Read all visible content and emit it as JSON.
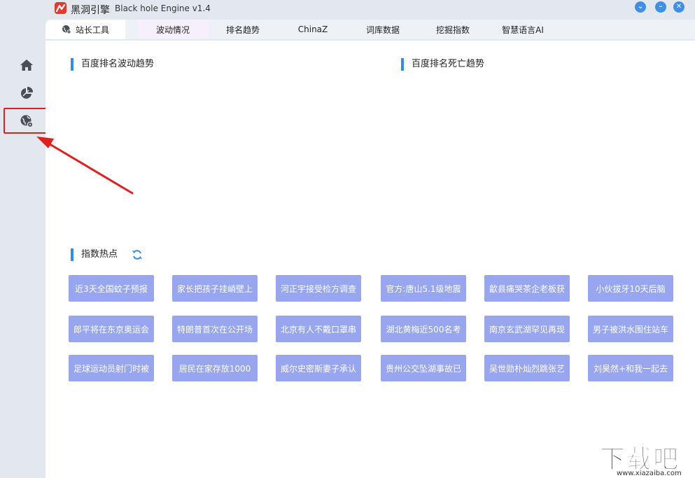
{
  "app": {
    "title": "黑洞引擎",
    "subtitle": "Black hole Engine v1.4",
    "accent": "#3f8fe6",
    "logo_color": "#e33a2c"
  },
  "window_controls": [
    {
      "name": "collapse",
      "glyph": "⌄",
      "icon": "chevron-down-icon"
    },
    {
      "name": "minimize",
      "glyph": "–",
      "icon": "minimize-icon"
    },
    {
      "name": "close",
      "glyph": "✕",
      "icon": "close-icon"
    }
  ],
  "sidebar": {
    "items": [
      {
        "icon": "home-icon"
      },
      {
        "icon": "pie-chart-icon"
      },
      {
        "icon": "globe-gear-icon",
        "highlighted": true
      }
    ]
  },
  "tabs": [
    {
      "label": "站长工具",
      "icon": "globe-gear-icon",
      "active": true
    },
    {
      "label": "波动情况"
    },
    {
      "label": "排名趋势"
    },
    {
      "label": "ChinaZ"
    },
    {
      "label": "词库数据"
    },
    {
      "label": "挖掘指数"
    },
    {
      "label": "智慧语言AI"
    }
  ],
  "sections": {
    "fluctuation": "百度排名波动趋势",
    "dead": "百度排名死亡趋势",
    "hot": "指数热点"
  },
  "hot_items": [
    "近3天全国蚊子预报",
    "家长把孩子挂峭壁上",
    "河正宇接受检方调查",
    "官方:唐山5.1级地震",
    "歙县痛哭茶企老板获",
    "小伙拔牙10天后脑",
    "郎平将在东京奥运会",
    "特朗普首次在公开场",
    "北京有人不戴口罩串",
    "湖北黄梅近500名考",
    "南京玄武湖罕见再现",
    "男子被洪水围住站车",
    "足球运动员射门时被",
    "居民在家存放1000",
    "威尔史密斯妻子承认",
    "贵州公交坠湖事故已",
    "吴世勋朴灿烈跳张艺",
    "刘昊然+和我一起去"
  ],
  "hot_color": "#97a6ef",
  "watermark": {
    "text": "下载吧",
    "url": "www.xiazaiba.com"
  }
}
